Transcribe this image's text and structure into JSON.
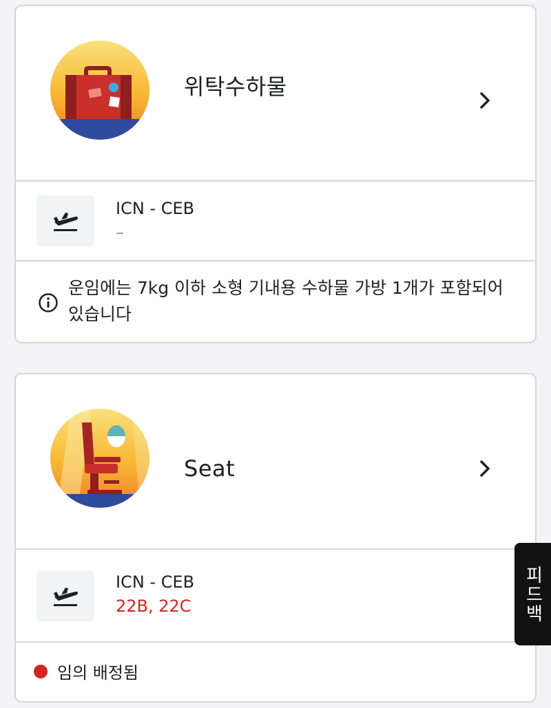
{
  "baggage_card": {
    "title": "위탁수하물",
    "icon": "luggage-icon",
    "route": "ICN - CEB",
    "route_detail": "–",
    "info_text": "운임에는 7kg 이하 소형 기내용 수하물 가방 1개가 포함되어 있습니다"
  },
  "seat_card": {
    "title": "Seat",
    "icon": "seat-icon",
    "route": "ICN - CEB",
    "seats": "22B, 22C",
    "status": "임의 배정됨"
  },
  "feedback_tab": {
    "label": "피드백"
  },
  "colors": {
    "accent_red": "#d3261f",
    "border": "#d4d5dc",
    "background": "#f4f4f6"
  }
}
